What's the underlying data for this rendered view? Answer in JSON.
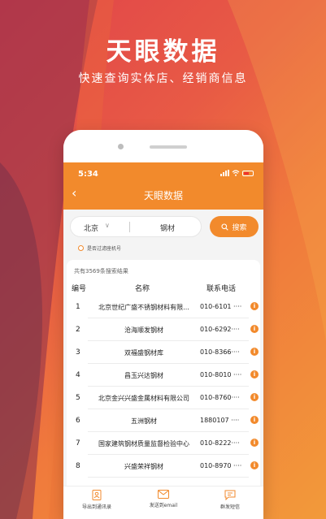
{
  "promo": {
    "title": "天眼数据",
    "subtitle": "快速查询实体店、经销商信息"
  },
  "status_bar": {
    "time": "5:34"
  },
  "header": {
    "title": "天眼数据"
  },
  "search": {
    "city": "北京",
    "keyword": "钢材",
    "button_label": "搜索"
  },
  "filter": {
    "label": "是否过滤座机号"
  },
  "results": {
    "count_text": "共有3569条搜索结果",
    "columns": {
      "num": "编号",
      "name": "名称",
      "phone": "联系电话"
    },
    "rows": [
      {
        "num": "1",
        "name": "北京世纪广盛不锈钢材料有限...",
        "phone": "010-6101 ····"
      },
      {
        "num": "2",
        "name": "沧海顺发钢材",
        "phone": "010-6292····"
      },
      {
        "num": "3",
        "name": "双福盛钢材库",
        "phone": "010-8366····"
      },
      {
        "num": "4",
        "name": "昌玉兴达钢材",
        "phone": "010-8010 ····"
      },
      {
        "num": "5",
        "name": "北京金兴兴盛金属材料有限公司",
        "phone": "010-8760····"
      },
      {
        "num": "6",
        "name": "五洲钢材",
        "phone": "1880107 ····"
      },
      {
        "num": "7",
        "name": "国家建筑钢材质量监督检验中心",
        "phone": "010-8222····"
      },
      {
        "num": "8",
        "name": "兴盛荣祥钢材",
        "phone": "010-8970 ····"
      }
    ]
  },
  "bottom_bar": {
    "tabs": [
      {
        "label": "导出到通讯录",
        "icon": "contacts-icon"
      },
      {
        "label": "发送到email",
        "icon": "email-icon"
      },
      {
        "label": "群发短信",
        "icon": "message-icon"
      }
    ]
  },
  "colors": {
    "accent": "#f28a2c",
    "background_start": "#e0434a",
    "background_end": "#f29a3a"
  }
}
